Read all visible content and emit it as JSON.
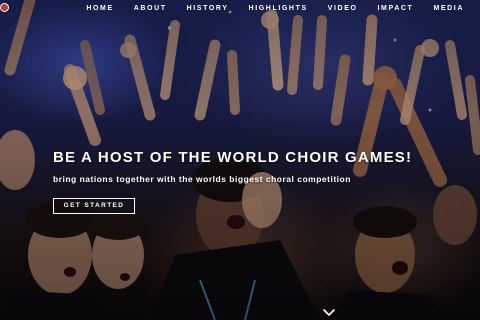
{
  "nav": {
    "items": [
      {
        "label": "HOME"
      },
      {
        "label": "ABOUT"
      },
      {
        "label": "HISTORY"
      },
      {
        "label": "HIGHLIGHTS"
      },
      {
        "label": "VIDEO"
      },
      {
        "label": "IMPACT"
      },
      {
        "label": "MEDIA"
      }
    ]
  },
  "hero": {
    "headline": "BE A HOST OF THE WORLD CHOIR GAMES!",
    "tagline": "bring nations together with the worlds biggest choral competition",
    "cta_label": "GET STARTED",
    "background_image": "crowd of singers with raised hands on stage"
  },
  "icons": {
    "logo": "logo-badge-icon",
    "scroll": "chevron-down-icon"
  },
  "colors": {
    "text": "#ffffff",
    "logo": "#c0392b"
  }
}
